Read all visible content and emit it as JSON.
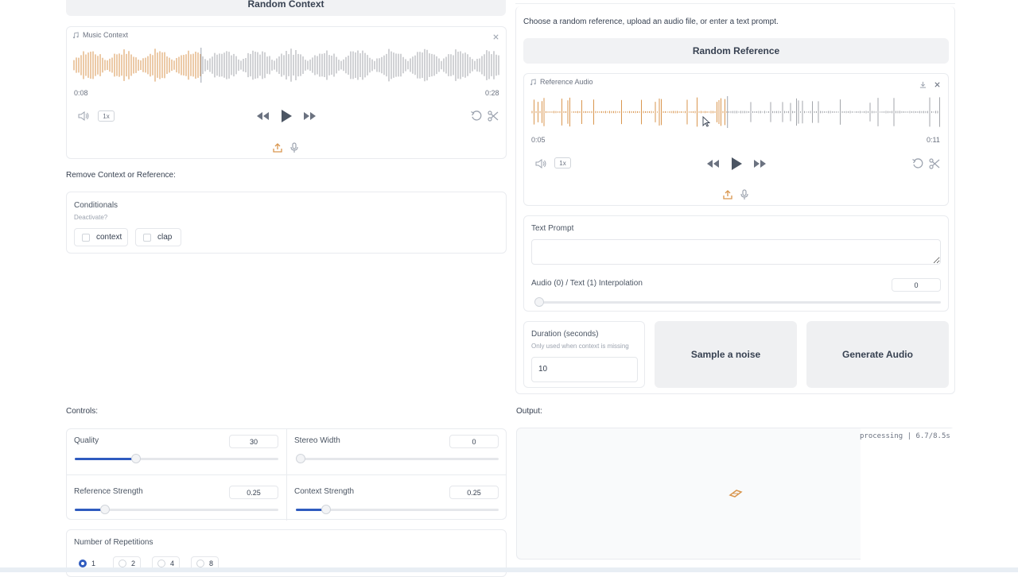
{
  "left": {
    "random_context_label": "Random Context",
    "music_context": {
      "tag": "Music Context",
      "time_current": "0:08",
      "time_total": "0:28",
      "speed": "1x",
      "played_fraction": 0.3
    },
    "remove_label": "Remove Context or Reference:",
    "conditionals": {
      "title": "Conditionals",
      "subtitle": "Deactivate?",
      "options": [
        "context",
        "clap"
      ]
    }
  },
  "right": {
    "instruction": "Choose a random reference, upload an audio file, or enter a text prompt.",
    "random_reference_label": "Random Reference",
    "reference_audio": {
      "tag": "Reference Audio",
      "time_current": "0:05",
      "time_total": "0:11",
      "speed": "1x",
      "played_fraction": 0.48
    },
    "text_prompt": {
      "label": "Text Prompt",
      "value": ""
    },
    "interpolation": {
      "label": "Audio (0) / Text (1) Interpolation",
      "value": "0",
      "fraction": 0
    },
    "duration": {
      "label": "Duration (seconds)",
      "hint": "Only used when context is missing",
      "value": "10"
    },
    "sample_noise_label": "Sample a noise",
    "generate_audio_label": "Generate Audio"
  },
  "controls": {
    "label": "Controls:",
    "quality": {
      "label": "Quality",
      "value": "30",
      "fraction": 0.3
    },
    "stereo_width": {
      "label": "Stereo Width",
      "value": "0",
      "fraction": 0
    },
    "reference_strength": {
      "label": "Reference Strength",
      "value": "0.25",
      "fraction": 0.15
    },
    "context_strength": {
      "label": "Context Strength",
      "value": "0.25",
      "fraction": 0.15
    },
    "repetitions": {
      "label": "Number of Repetitions",
      "options": [
        "1",
        "2",
        "4",
        "8"
      ],
      "selected": "1"
    }
  },
  "output": {
    "label": "Output:",
    "status": "processing | 6.7/8.5s"
  },
  "colors": {
    "accent": "#2f5bbf",
    "wave_played": "#d9964f",
    "wave_rest": "#a3a6ab"
  }
}
